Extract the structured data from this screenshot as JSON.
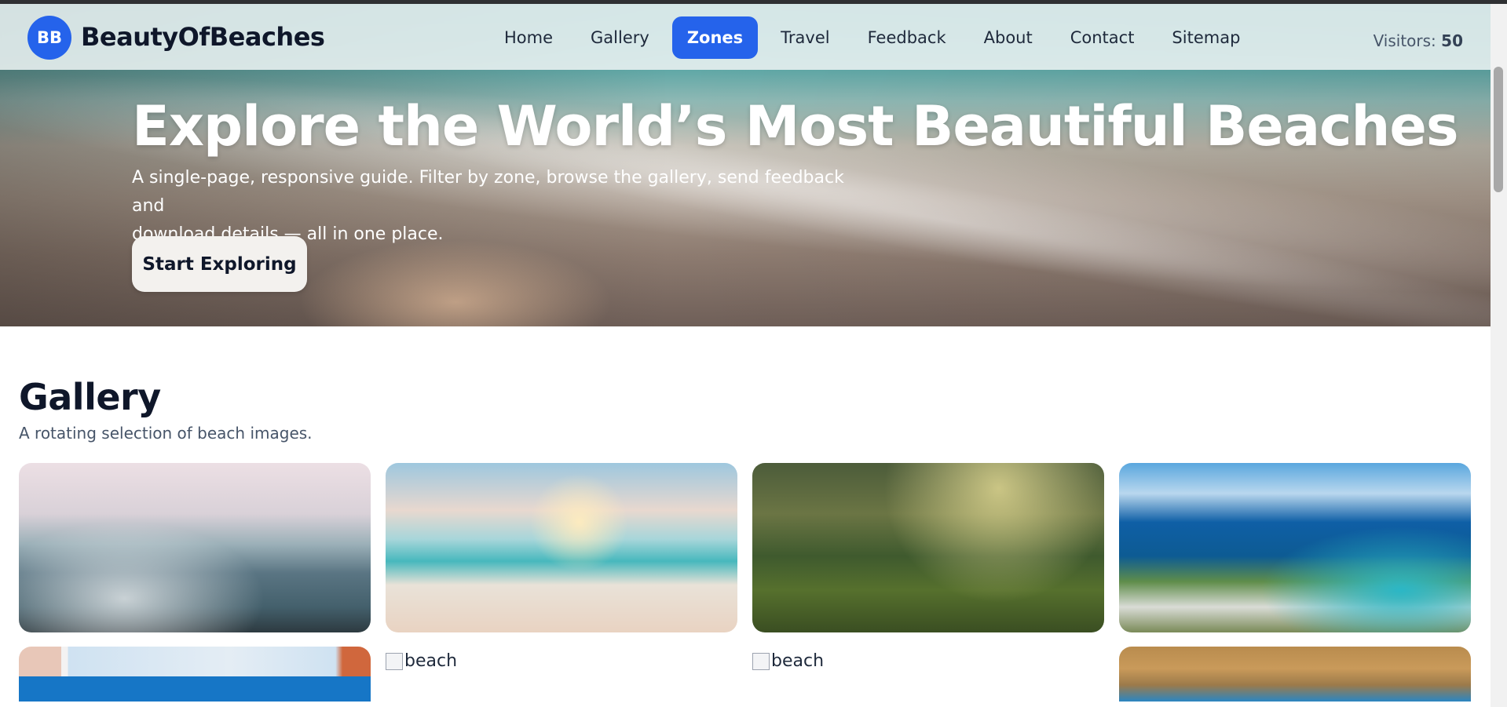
{
  "brand": {
    "badge": "BB",
    "name": "BeautyOfBeaches"
  },
  "nav": {
    "items": [
      {
        "label": "Home"
      },
      {
        "label": "Gallery"
      },
      {
        "label": "Zones",
        "active": true
      },
      {
        "label": "Travel"
      },
      {
        "label": "Feedback"
      },
      {
        "label": "About"
      },
      {
        "label": "Contact"
      },
      {
        "label": "Sitemap"
      }
    ]
  },
  "visitors": {
    "label": "Visitors:",
    "count": "50"
  },
  "hero": {
    "title": "Explore the World’s Most Beautiful Beaches",
    "subtitle_line1": "A single-page, responsive guide. Filter by zone, browse the gallery, send feedback and",
    "subtitle_line2": "download details — all in one place.",
    "cta": "Start Exploring"
  },
  "gallery": {
    "title": "Gallery",
    "subtitle": "A rotating selection of beach images.",
    "broken_alt": "beach"
  },
  "colors": {
    "accent": "#2563eb",
    "heading": "#0f172a"
  }
}
